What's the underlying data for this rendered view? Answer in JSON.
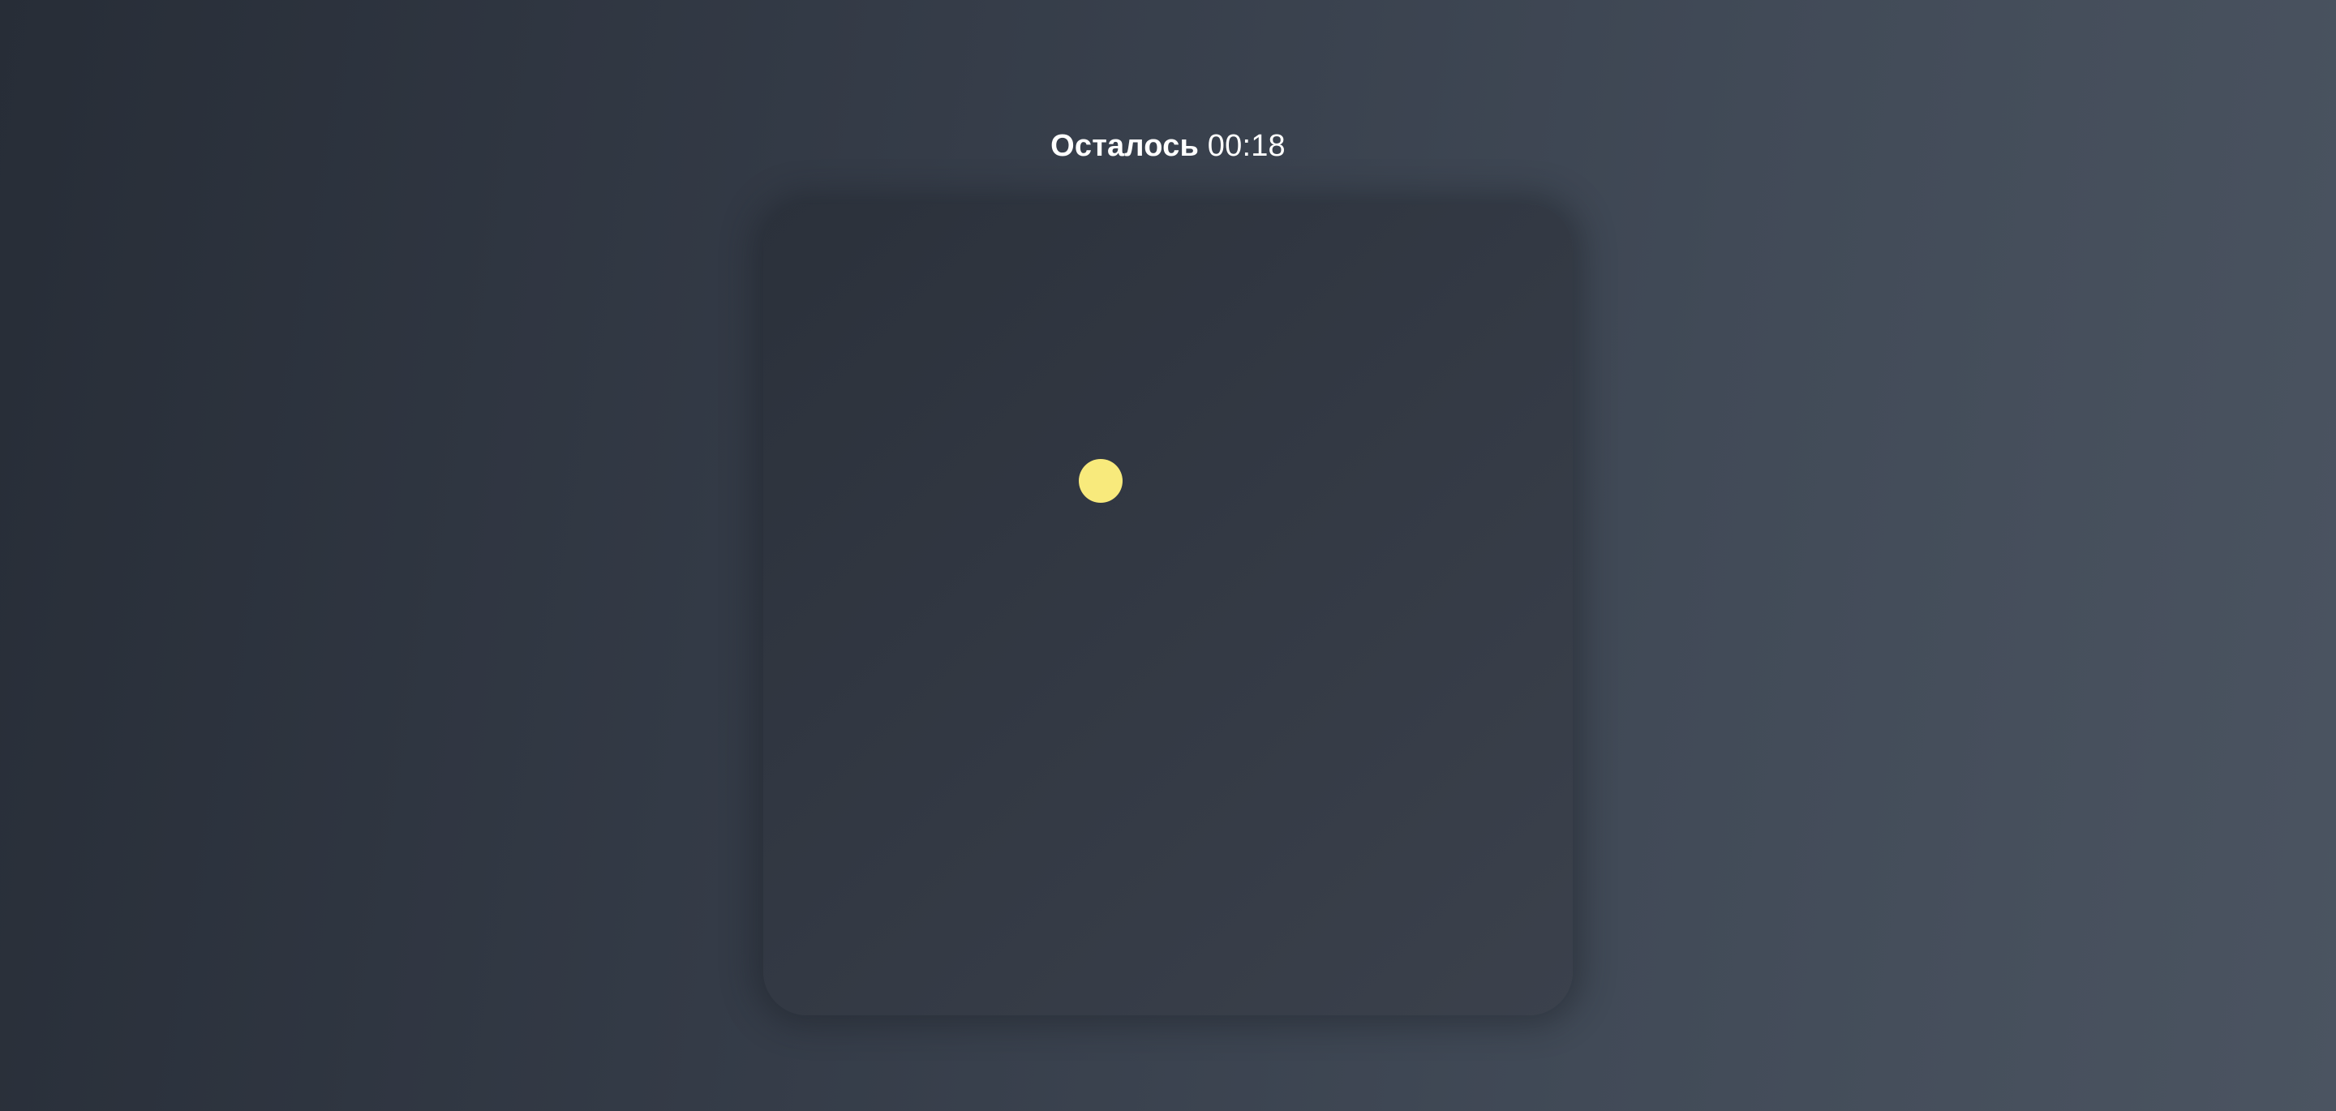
{
  "timer": {
    "label": "Осталось",
    "value": "00:18"
  },
  "target": {
    "icon": "yellow-dot-icon",
    "color": "#f8ea7c"
  },
  "board": {
    "color": "#333944"
  }
}
